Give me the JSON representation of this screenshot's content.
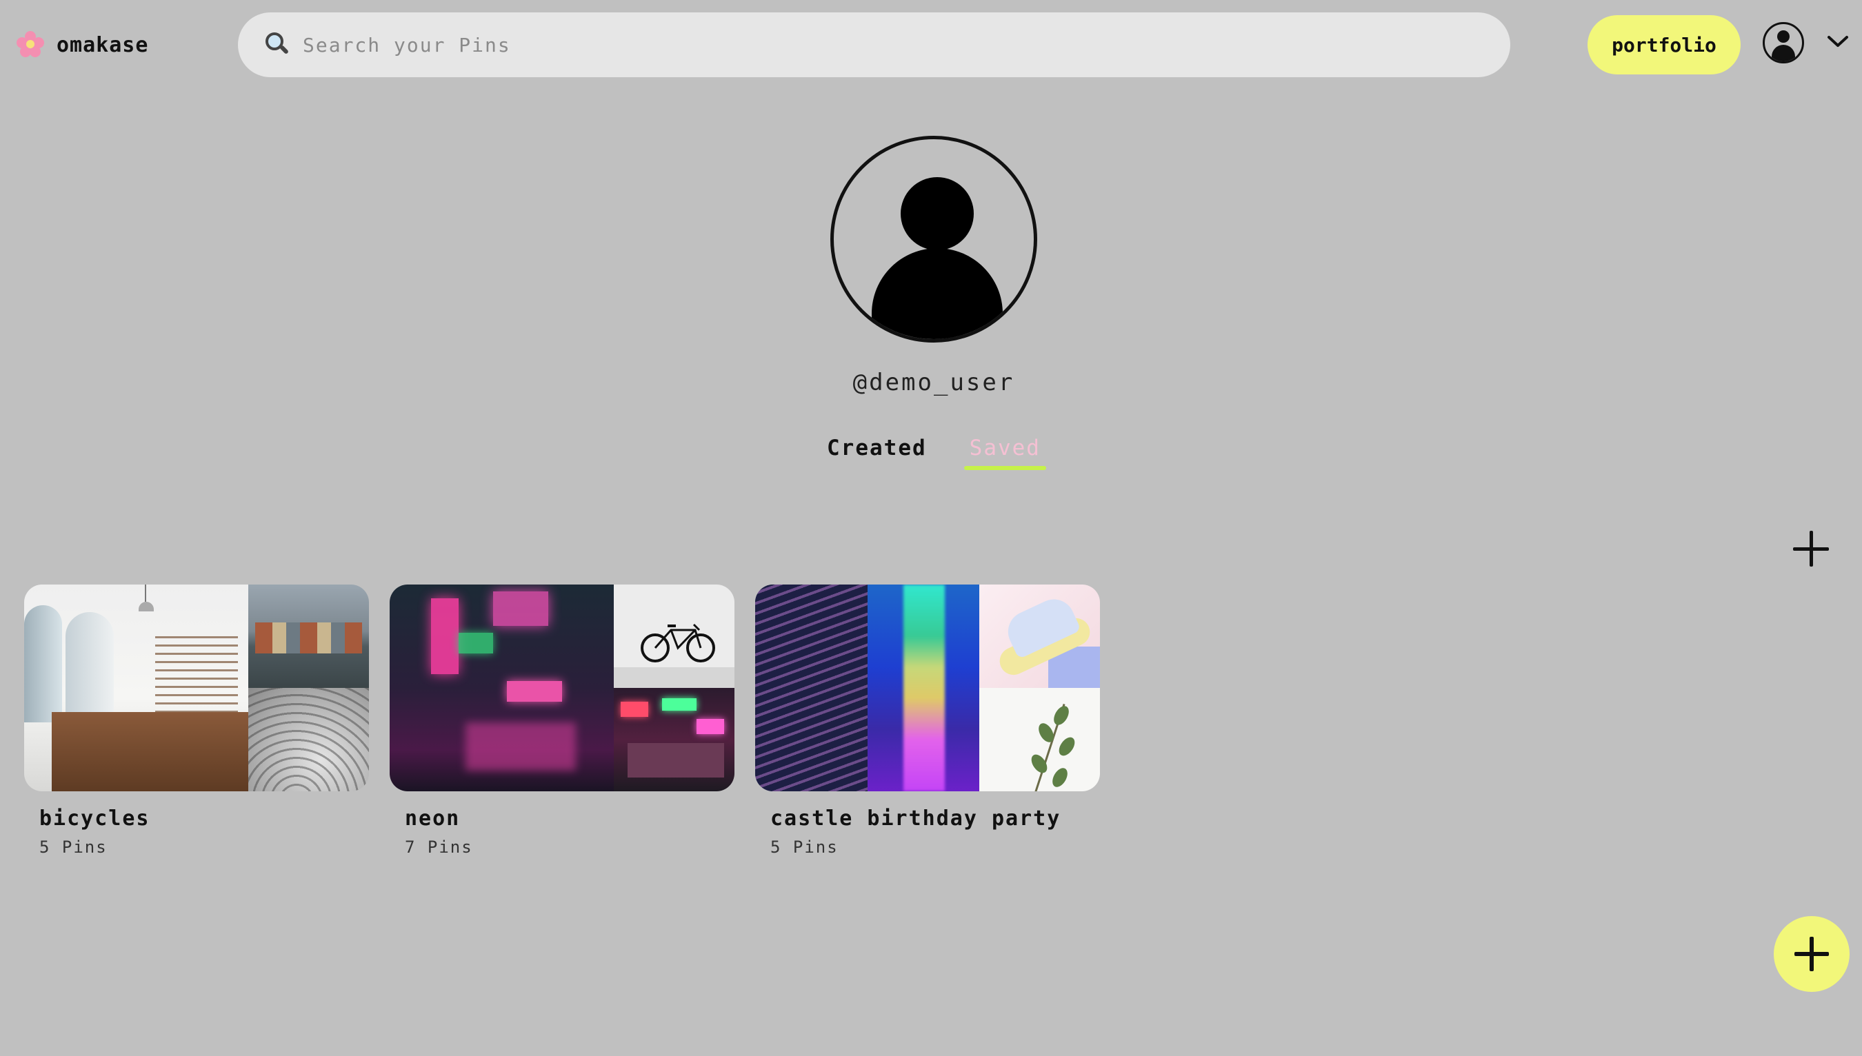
{
  "header": {
    "brand_name": "omakase",
    "brand_icon": "flower-icon",
    "search": {
      "placeholder": "Search your Pins",
      "value": ""
    },
    "portfolio_label": "portfolio",
    "avatar_icon": "user-avatar-icon",
    "menu_icon": "chevron-down-icon"
  },
  "profile": {
    "username": "@demo_user",
    "tabs": [
      {
        "label": "Created",
        "active": false
      },
      {
        "label": "Saved",
        "active": true
      }
    ]
  },
  "boards": [
    {
      "title": "bicycles",
      "count": "5 Pins"
    },
    {
      "title": "neon",
      "count": "7 Pins"
    },
    {
      "title": "castle birthday party",
      "count": "5 Pins"
    }
  ],
  "colors": {
    "background": "#c0c0c0",
    "accent_yellow": "#f2f77a",
    "saved_tab_text": "#f5c0d3",
    "saved_tab_underline": "#c6f24a"
  }
}
